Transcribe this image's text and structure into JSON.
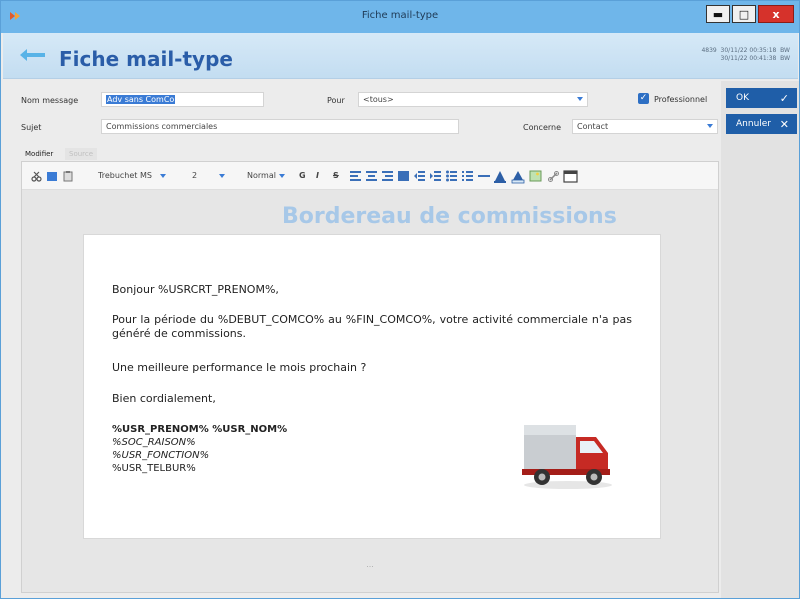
{
  "window": {
    "title": "Fiche mail-type"
  },
  "header": {
    "title": "Fiche mail-type",
    "meta": "4839  30/11/22 00:35:18  BW\n30/11/22 00:41:38  BW"
  },
  "form": {
    "nom_label": "Nom message",
    "nom_value": "Adv sans ComCo",
    "pour_label": "Pour",
    "pour_value": "<tous>",
    "professionnel_label": "Professionnel",
    "sujet_label": "Sujet",
    "sujet_value": "Commissions commerciales",
    "concerne_label": "Concerne",
    "concerne_value": "Contact"
  },
  "buttons": {
    "ok_label": "OK",
    "annuler_label": "Annuler"
  },
  "tabs": {
    "modifier": "Modifier",
    "source": "Source"
  },
  "toolbar": {
    "font": "Trebuchet MS",
    "size": "2",
    "style": "Normal",
    "bold": "G",
    "italic": "I",
    "strike": "S"
  },
  "document": {
    "heading": "Bordereau de commissions",
    "greeting": "Bonjour %USRCRT_PRENOM%,",
    "para1": "Pour la période du %DEBUT_COMCO% au %FIN_COMCO%, votre activité commerciale n'a pas généré de commissions.",
    "para2": "Une meilleure performance le mois prochain ?",
    "closing": "Bien cordialement,",
    "sig_name": "%USR_PRENOM% %USR_NOM%",
    "sig_company": "%SOC_RAISON%",
    "sig_function": "%USR_FONCTION%",
    "sig_tel": "%USR_TELBUR%"
  },
  "footer": {
    "dots": "..."
  },
  "colors": {
    "accent": "#1f5ea8",
    "titlebar": "#6fb6ea",
    "heading": "#a7c8e8"
  }
}
